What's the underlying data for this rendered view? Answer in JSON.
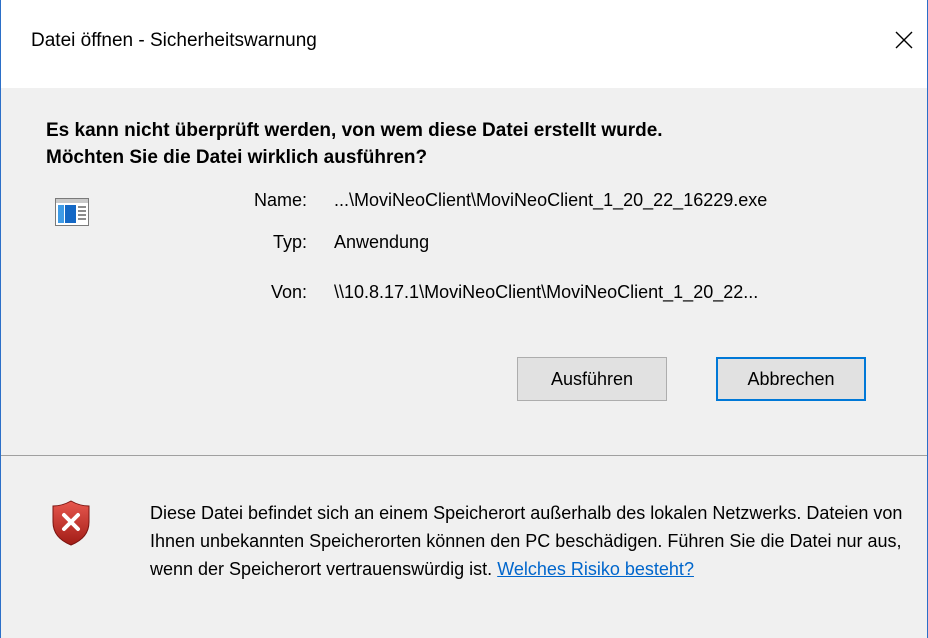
{
  "window": {
    "title": "Datei öffnen - Sicherheitswarnung",
    "close_glyph": "✕"
  },
  "headline": {
    "line1": "Es kann nicht überprüft werden, von wem diese Datei erstellt wurde.",
    "line2": "Möchten Sie die Datei wirklich ausführen?"
  },
  "file_info": {
    "icon": "application-window-icon",
    "name_label": "Name:",
    "name_value": "...\\MoviNeoClient\\MoviNeoClient_1_20_22_16229.exe",
    "type_label": "Typ:",
    "type_value": "Anwendung",
    "from_label": "Von:",
    "from_value": "\\\\10.8.17.1\\MoviNeoClient\\MoviNeoClient_1_20_22..."
  },
  "buttons": {
    "run_label": "Ausführen",
    "cancel_label": "Abbrechen"
  },
  "warning": {
    "icon": "shield-error-icon",
    "text": "Diese Datei befindet sich an einem Speicherort außerhalb des lokalen Netzwerks. Dateien von Ihnen unbekannten Speicherorten können den PC beschädigen. Führen Sie die Datei nur aus, wenn der Speicherort vertrauenswürdig ist.",
    "link": "Welches Risiko besteht?"
  },
  "colors": {
    "accent": "#0078d7",
    "link": "#0066cc",
    "shield": "#c62828",
    "background": "#f0f0f0"
  }
}
